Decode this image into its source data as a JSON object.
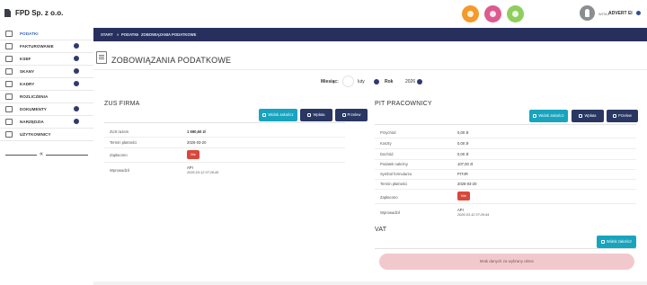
{
  "header": {
    "company": "FPD Sp. z o.o.",
    "user_prefix": "WITAJ",
    "user_name": "ADVERT EI"
  },
  "sidebar": {
    "items": [
      {
        "label": "PODATKI",
        "icon": "tax-icon",
        "has_chevron": false
      },
      {
        "label": "FAKTUROWANIE",
        "icon": "invoice-icon",
        "has_chevron": true
      },
      {
        "label": "KSEF",
        "icon": "ksef-icon",
        "has_chevron": true
      },
      {
        "label": "SKANY",
        "icon": "scan-icon",
        "has_chevron": true
      },
      {
        "label": "KADRY",
        "icon": "people-icon",
        "has_chevron": true
      },
      {
        "label": "ROZLICZENIA",
        "icon": "settlement-icon",
        "has_chevron": false
      },
      {
        "label": "DOKUMENTY",
        "icon": "documents-icon",
        "has_chevron": true
      },
      {
        "label": "NARZĘDZIA",
        "icon": "tools-icon",
        "has_chevron": true
      },
      {
        "label": "UŻYTKOWNICY",
        "icon": "users-icon",
        "has_chevron": false
      }
    ],
    "collapse_glyph": "«"
  },
  "breadcrumb": [
    "START",
    "»",
    "PODATKI",
    "»",
    "ZOBOWIĄZANIA PODATKOWE"
  ],
  "page": {
    "title": "ZOBOWIĄZANIA PODATKOWE"
  },
  "filter": {
    "month_label": "Miesiąc:",
    "month_value": "luty",
    "year_label": "Rok",
    "year_value": "2026"
  },
  "zus": {
    "title": "ZUS FIRMA",
    "buttons": [
      "Widok zakończ",
      "Wpłata",
      "Przelew"
    ],
    "rows": [
      {
        "label": "ZUS razem",
        "value": "1 590,60 zł"
      },
      {
        "label": "Termin płatności",
        "value": "2026-03-20"
      },
      {
        "label": "Zapłacono",
        "value": "Nie"
      },
      {
        "label": "Wprowadził",
        "value": "API",
        "sub": "2026-03-12 07:26:45"
      }
    ]
  },
  "pit": {
    "title": "PIT PRACOWNICY",
    "buttons": [
      "Widok zakończ",
      "Wpłata",
      "Przelew"
    ],
    "rows": [
      {
        "label": "Przychód",
        "value": "0,00 zł"
      },
      {
        "label": "Koszty",
        "value": "0,00 zł"
      },
      {
        "label": "Dochód",
        "value": "0,00 zł"
      },
      {
        "label": "Podatek należny",
        "value": "107,00 zł"
      },
      {
        "label": "Symbol formularza",
        "value": "PIT4R"
      },
      {
        "label": "Termin płatności",
        "value": "2026-03-20"
      },
      {
        "label": "Zapłacono",
        "value": "Nie"
      },
      {
        "label": "Wprowadził",
        "value": "API",
        "sub": "2026-03-12 07:26:44"
      }
    ]
  },
  "vat": {
    "title": "VAT",
    "button": "Widok zakończ",
    "empty_text": "Brak danych za wybrany okres"
  },
  "colors": {
    "breadcrumb_bg": "#27305c",
    "teal_button": "#17a4be",
    "navy_button": "#293762",
    "unpaid_badge": "#d9473a",
    "empty_box": "#f1c9cc",
    "orange_circle": "#f39a2a",
    "pink_circle": "#dc5b8e",
    "green_circle": "#8fce5c"
  }
}
